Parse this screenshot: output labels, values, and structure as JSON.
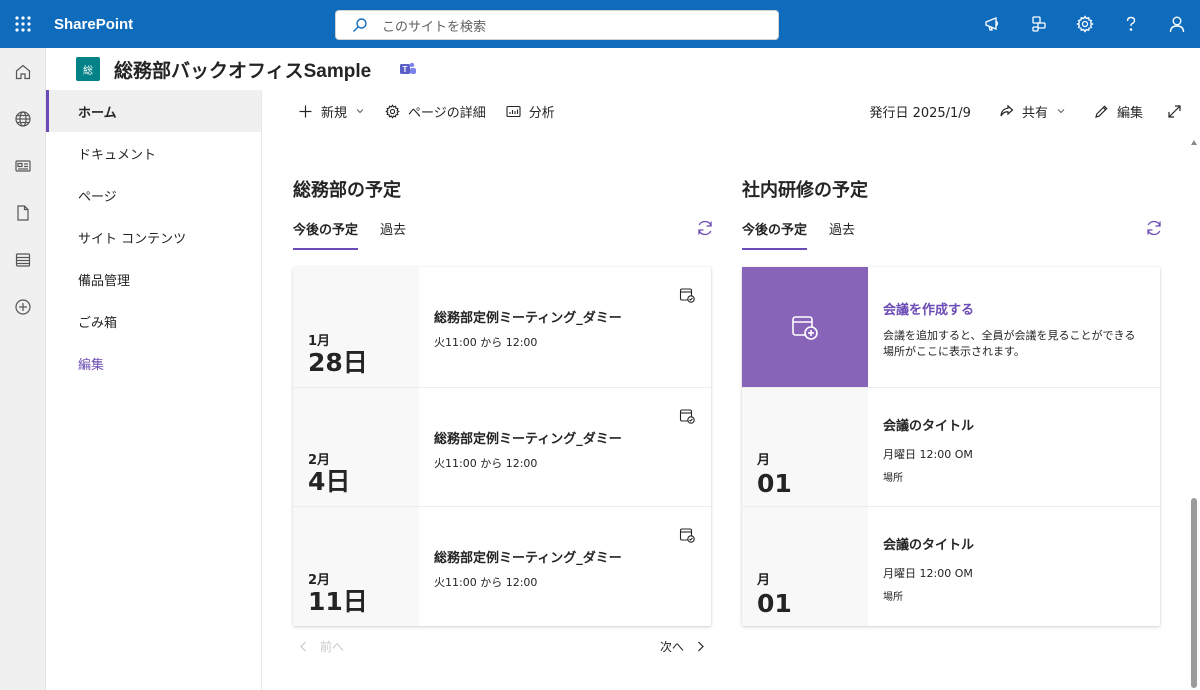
{
  "suite": {
    "app_name": "SharePoint",
    "search_placeholder": "このサイトを検索"
  },
  "site": {
    "logo_text": "総",
    "title": "総務部バックオフィスSample",
    "logo_color": "#038387"
  },
  "nav": {
    "items": [
      {
        "label": "ホーム"
      },
      {
        "label": "ドキュメント"
      },
      {
        "label": "ページ"
      },
      {
        "label": "サイト コンテンツ"
      },
      {
        "label": "備品管理"
      },
      {
        "label": "ごみ箱"
      },
      {
        "label": "編集"
      }
    ]
  },
  "command": {
    "new": "新規",
    "page_details": "ページの詳細",
    "analytics": "分析",
    "published": "発行日 2025/1/9",
    "share": "共有",
    "edit": "編集"
  },
  "sections": {
    "general_affairs": {
      "title": "総務部の予定",
      "tab_upcoming": "今後の予定",
      "tab_past": "過去",
      "events": [
        {
          "month": "1月",
          "day": "28日",
          "title": "総務部定例ミーティング_ダミー",
          "time": "火11:00 から 12:00"
        },
        {
          "month": "2月",
          "day": "4日",
          "title": "総務部定例ミーティング_ダミー",
          "time": "火11:00 から 12:00"
        },
        {
          "month": "2月",
          "day": "11日",
          "title": "総務部定例ミーティング_ダミー",
          "time": "火11:00 から 12:00"
        }
      ],
      "prev": "前へ",
      "next": "次へ"
    },
    "training": {
      "title": "社内研修の予定",
      "tab_upcoming": "今後の予定",
      "tab_past": "過去",
      "create_title": "会議を作成する",
      "create_desc": "会議を追加すると、全員が会議を見ることができる場所がここに表示されます。",
      "events": [
        {
          "month": "月",
          "day": "01",
          "title": "会議のタイトル",
          "time": "月曜日 12:00 OM",
          "location": "場所"
        },
        {
          "month": "月",
          "day": "01",
          "title": "会議のタイトル",
          "time": "月曜日 12:00 OM",
          "location": "場所"
        }
      ]
    }
  },
  "colors": {
    "suite_bar": "#0f6cbd",
    "accent": "#6b4bb5",
    "create_tile": "#8764b8"
  }
}
